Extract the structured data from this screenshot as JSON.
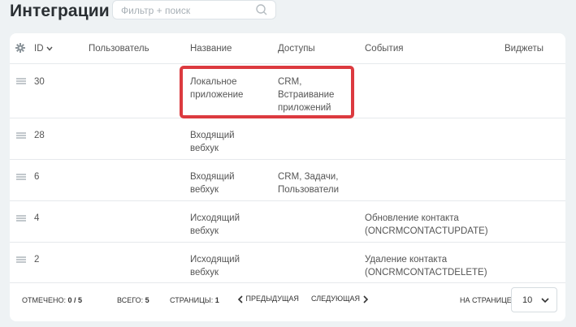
{
  "header": {
    "title": "Интеграции",
    "search_placeholder": "Фильтр + поиск"
  },
  "table": {
    "columns": {
      "id": "ID",
      "user": "Пользователь",
      "name": "Название",
      "access": "Доступы",
      "events": "События",
      "widgets": "Виджеты"
    },
    "rows": [
      {
        "id": "30",
        "name": [
          "Локальное",
          "приложение"
        ],
        "access": [
          "CRM,",
          "Встраивание",
          "приложений"
        ],
        "events": [
          "",
          ""
        ]
      },
      {
        "id": "28",
        "name": [
          "Входящий",
          "вебхук"
        ],
        "access": [
          "",
          ""
        ],
        "events": [
          "",
          ""
        ]
      },
      {
        "id": "6",
        "name": [
          "Входящий",
          "вебхук"
        ],
        "access": [
          "CRM, Задачи,",
          "Пользователи"
        ],
        "events": [
          "",
          ""
        ]
      },
      {
        "id": "4",
        "name": [
          "Исходящий",
          "вебхук"
        ],
        "access": [
          "",
          ""
        ],
        "events": [
          "Обновление контакта",
          "(ONCRMCONTACTUPDATE)"
        ]
      },
      {
        "id": "2",
        "name": [
          "Исходящий",
          "вебхук"
        ],
        "access": [
          "",
          ""
        ],
        "events": [
          "Удаление контакта",
          "(ONCRMCONTACTDELETE)"
        ]
      }
    ]
  },
  "footer": {
    "selected_label": "Отмечено:",
    "selected_value": "0 / 5",
    "total_label": "Всего:",
    "total_value": "5",
    "pages_label": "Страницы:",
    "pages_value": "1",
    "prev_label": "Предыдущая",
    "next_label": "Следующая",
    "per_page_label": "На странице:",
    "per_page_value": "10"
  },
  "colors": {
    "highlight": "#dc3a3f",
    "background": "#eef2f4"
  }
}
